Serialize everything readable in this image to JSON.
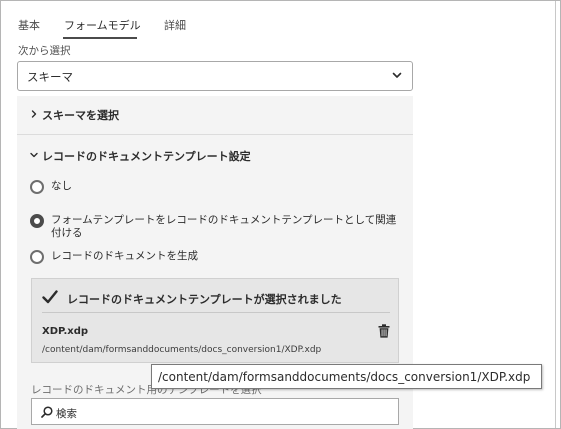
{
  "tabs": [
    {
      "label": "基本"
    },
    {
      "label": "フォームモデル"
    },
    {
      "label": "詳細"
    }
  ],
  "source_select": {
    "label": "次から選択",
    "value": "スキーマ"
  },
  "sections": {
    "schema_select": "スキーマを選択",
    "dor_template": "レコードのドキュメントテンプレート設定"
  },
  "radios": [
    {
      "label": "なし",
      "checked": false
    },
    {
      "label": "フォームテンプレートをレコードのドキュメントテンプレートとして関連付ける",
      "checked": true
    },
    {
      "label": "レコードのドキュメントを生成",
      "checked": false
    }
  ],
  "selected_template": {
    "title": "レコードのドキュメントテンプレートが選択されました",
    "file_name": "XDP.xdp",
    "file_path": "/content/dam/formsanddocuments/docs_conversion1/XDP.xdp"
  },
  "template_picker": {
    "label": "レコードのドキュメント用のテンプレートを選択",
    "search_placeholder": "検索"
  },
  "tooltip": {
    "text": "/content/dam/formsanddocuments/docs_conversion1/XDP.xdp"
  }
}
